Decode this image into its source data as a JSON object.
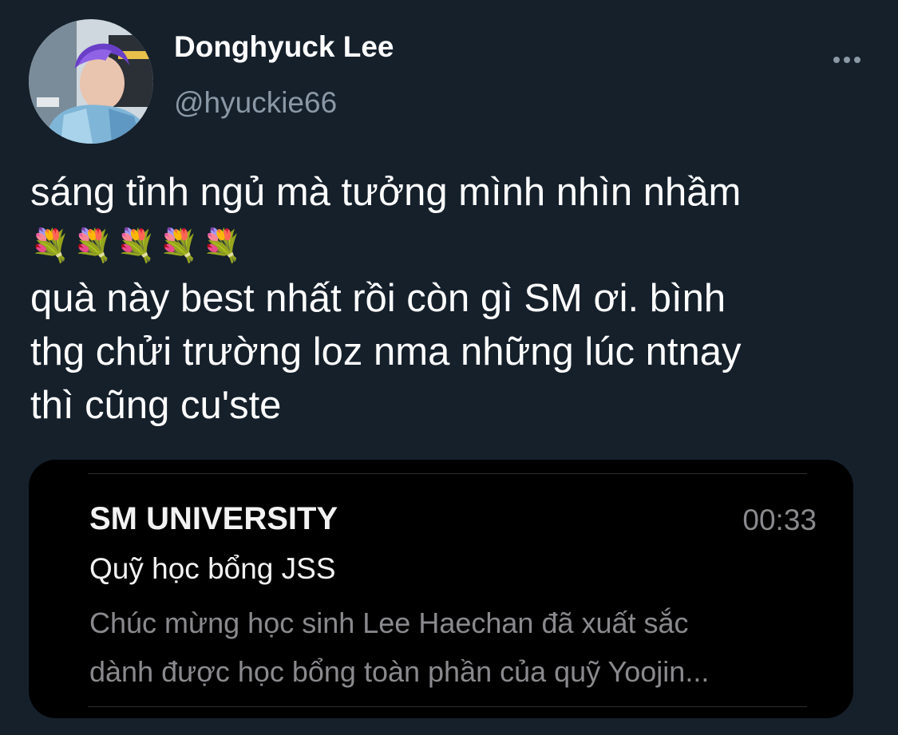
{
  "tweet": {
    "author": {
      "display_name": "Donghyuck Lee",
      "handle": "@hyuckie66",
      "avatar_icon": "profile-photo"
    },
    "more_icon": "more-horizontal-icon",
    "text_lines": {
      "line1": "sáng tỉnh ngủ mà tưởng mình nhìn nhầm",
      "emoji_row": "💐💐💐💐💐",
      "line2": "quà này best nhất rồi còn gì SM ơi. bình",
      "line3": "thg chửi trường loz nma những lúc ntnay",
      "line4": "thì cũng cu'ste"
    },
    "media": {
      "notification": {
        "sender": "SM UNIVERSITY",
        "time": "00:33",
        "subject": "Quỹ học bổng JSS",
        "preview_line1": "Chúc mừng học sinh Lee Haechan đã xuất sắc",
        "preview_line2": "dành được học bổng toàn phần của quỹ Yoojin..."
      }
    }
  },
  "colors": {
    "background": "#15202b",
    "primary_text": "#ffffff",
    "secondary_text": "#8b98a5",
    "card_background": "#000000",
    "card_muted_text": "#8a8a8e"
  }
}
